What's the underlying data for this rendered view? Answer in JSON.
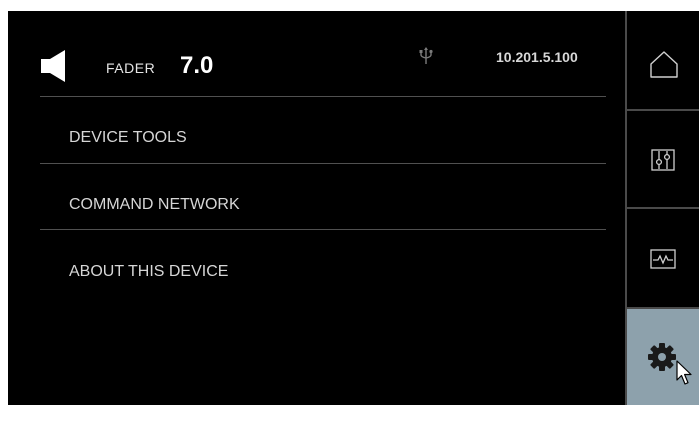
{
  "header": {
    "speaker_icon": "speaker-icon",
    "fader_label": "FADER",
    "fader_value": "7.0",
    "usb_icon": "usb-icon",
    "ip_address": "10.201.5.100"
  },
  "menu": {
    "items": [
      {
        "label": "DEVICE TOOLS"
      },
      {
        "label": "COMMAND NETWORK"
      },
      {
        "label": "ABOUT THIS DEVICE"
      }
    ]
  },
  "sidebar": {
    "items": [
      {
        "icon": "home-icon",
        "active": false
      },
      {
        "icon": "mixer-sliders-icon",
        "active": false
      },
      {
        "icon": "waveform-icon",
        "active": false
      },
      {
        "icon": "gear-icon",
        "active": true
      }
    ],
    "active_color": "#8da1ac"
  },
  "colors": {
    "background": "#000000",
    "text": "#d6d6d6",
    "divider": "#505050"
  }
}
